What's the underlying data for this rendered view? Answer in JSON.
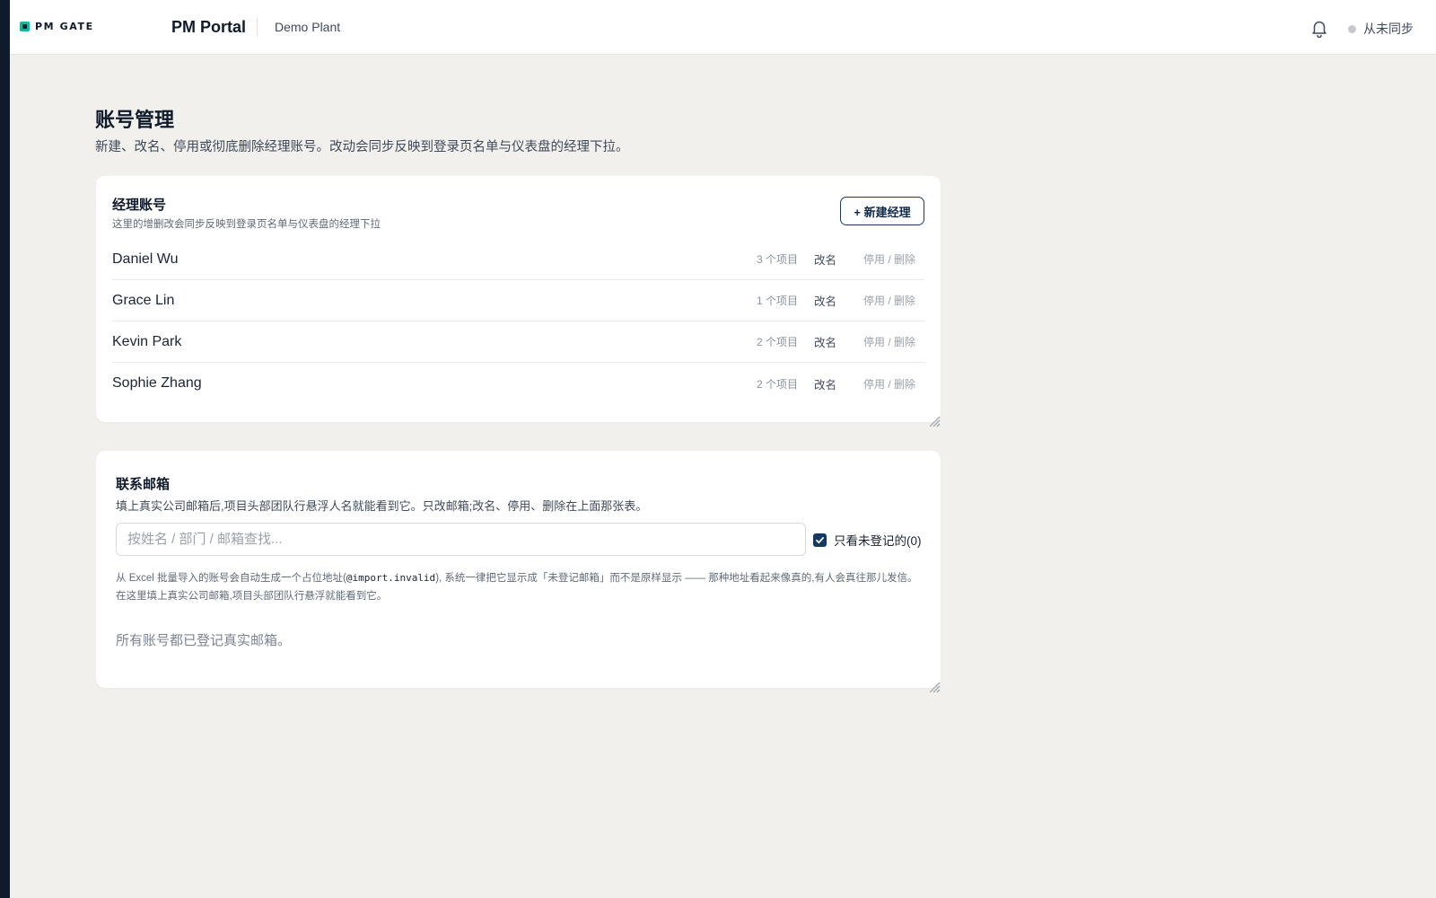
{
  "topbar": {
    "logo_text": "PM GATE",
    "app_name": "PM Portal",
    "plant": "Demo Plant",
    "sync_status": "从未同步"
  },
  "page": {
    "title": "账号管理",
    "description": "新建、改名、停用或彻底删除经理账号。改动会同步反映到登录页名单与仪表盘的经理下拉。"
  },
  "managers": {
    "title": "经理账号",
    "subtitle": "这里的增删改会同步反映到登录页名单与仪表盘的经理下拉",
    "new_button": "+ 新建经理",
    "rename_label": "改名",
    "disable_delete_label": "停用 / 删除",
    "rows": [
      {
        "name": "Daniel Wu",
        "count": "3 个项目"
      },
      {
        "name": "Grace Lin",
        "count": "1 个项目"
      },
      {
        "name": "Kevin Park",
        "count": "2 个项目"
      },
      {
        "name": "Sophie Zhang",
        "count": "2 个项目"
      }
    ]
  },
  "contact_email": {
    "title": "联系邮箱",
    "description": "填上真实公司邮箱后,项目头部团队行悬浮人名就能看到它。只改邮箱;改名、停用、删除在上面那张表。",
    "search_placeholder": "按姓名 / 部门 / 邮箱查找...",
    "filter_label": "只看未登记的(0)",
    "filter_checked": true,
    "note_before": "从 Excel 批量导入的账号会自动生成一个占位地址(",
    "note_code": "@import.invalid",
    "note_after": "), 系统一律把它显示成「未登记邮箱」而不是原样显示 —— 那种地址看起来像真的,有人会真往那儿发信。 在这里填上真实公司邮箱,项目头部团队行悬浮就能看到它。",
    "empty_message": "所有账号都已登记真实邮箱。"
  },
  "colors": {
    "accent": "#17b49b",
    "primary": "#163a5f",
    "background": "#f1f0ed"
  },
  "icons": [
    "bell-icon",
    "checkmark-icon",
    "resize-grip-icon"
  ]
}
